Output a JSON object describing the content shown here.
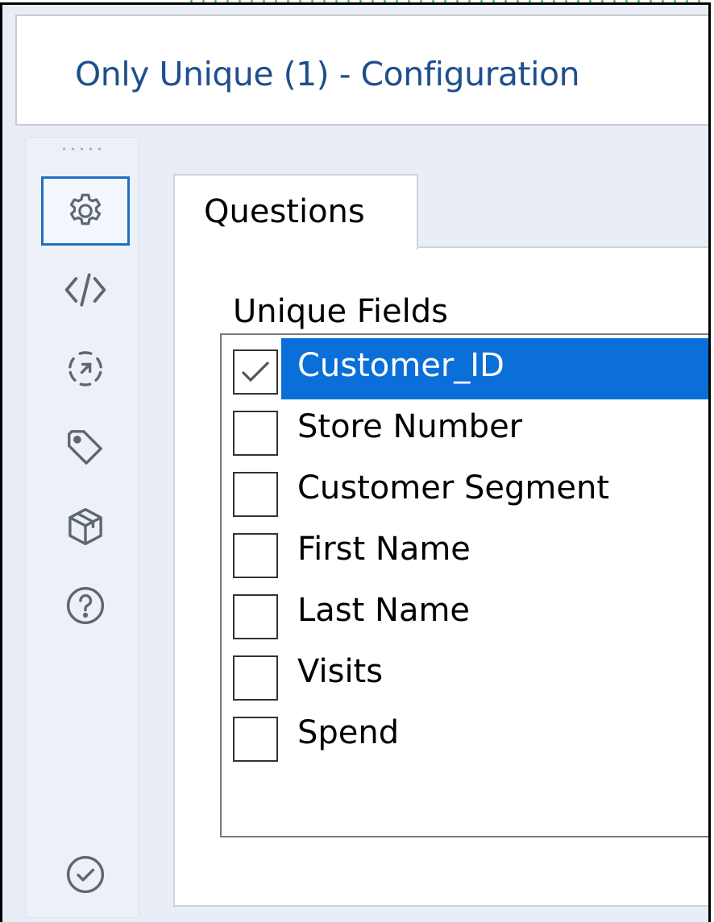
{
  "window": {
    "title": "Only Unique (1) - Configuration"
  },
  "sidebar": {
    "items": [
      {
        "name": "configuration",
        "icon": "gear-icon",
        "active": true
      },
      {
        "name": "xml-view",
        "icon": "code-icon",
        "active": false
      },
      {
        "name": "interface",
        "icon": "interface-arrow-icon",
        "active": false
      },
      {
        "name": "annotation",
        "icon": "tag-icon",
        "active": false
      },
      {
        "name": "metadata",
        "icon": "cube-icon",
        "active": false
      },
      {
        "name": "help",
        "icon": "question-icon",
        "active": false
      },
      {
        "name": "validation",
        "icon": "check-circle-icon",
        "active": false
      }
    ]
  },
  "tabs": [
    {
      "label": "Questions"
    }
  ],
  "unique_fields": {
    "heading": "Unique Fields",
    "items": [
      {
        "label": "Customer_ID",
        "checked": true,
        "selected": true
      },
      {
        "label": "Store Number",
        "checked": false,
        "selected": false
      },
      {
        "label": "Customer Segment",
        "checked": false,
        "selected": false
      },
      {
        "label": "First Name",
        "checked": false,
        "selected": false
      },
      {
        "label": "Last Name",
        "checked": false,
        "selected": false
      },
      {
        "label": "Visits",
        "checked": false,
        "selected": false
      },
      {
        "label": "Spend",
        "checked": false,
        "selected": false
      }
    ]
  },
  "colors": {
    "title": "#1e4f8c",
    "selection": "#0a6fd8",
    "active_border": "#1e6fc4",
    "icon": "#5f6670"
  }
}
